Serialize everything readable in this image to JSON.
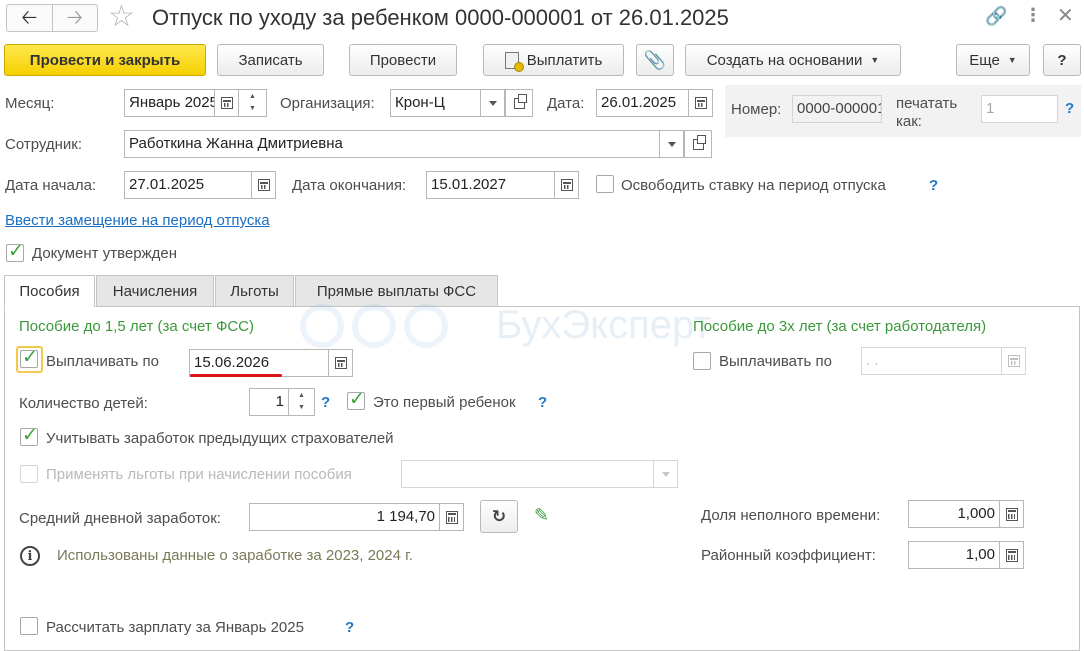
{
  "window": {
    "title": "Отпуск по уходу за ребенком 0000-000001 от 26.01.2025"
  },
  "toolbar": {
    "post_close": "Провести и закрыть",
    "save": "Записать",
    "post": "Провести",
    "pay": "Выплатить",
    "create_based": "Создать на основании",
    "more": "Еще",
    "help": "?"
  },
  "header": {
    "month_label": "Месяц:",
    "month_value": "Январь 2025",
    "org_label": "Организация:",
    "org_value": "Крон-Ц",
    "date_label": "Дата:",
    "date_value": "26.01.2025",
    "number_label": "Номер:",
    "number_value": "0000-000001",
    "print_as_label": "печатать как:",
    "print_as_value": "1",
    "employee_label": "Сотрудник:",
    "employee_value": "Работкина Жанна Дмитриевна",
    "start_label": "Дата начала:",
    "start_value": "27.01.2025",
    "end_label": "Дата окончания:",
    "end_value": "15.01.2027",
    "free_rate_label": "Освободить ставку на период отпуска",
    "substitution_link": "Ввести замещение на период отпуска",
    "approved_label": "Документ утвержден"
  },
  "tabs": [
    {
      "label": "Пособия"
    },
    {
      "label": "Начисления"
    },
    {
      "label": "Льготы"
    },
    {
      "label": "Прямые выплаты ФСС"
    }
  ],
  "benefits": {
    "fss_title": "Пособие до 1,5 лет (за счет ФСС)",
    "employer_title": "Пособие до 3х лет (за счет работодателя)",
    "pay_until_label": "Выплачивать по",
    "pay_until_value": "15.06.2026",
    "pay_until2_label": "Выплачивать по",
    "pay_until2_value": " .  .",
    "children_label": "Количество детей:",
    "children_value": "1",
    "first_child_label": "Это первый ребенок",
    "prev_insurers_label": "Учитывать заработок предыдущих страхователей",
    "apply_benefits_label": "Применять льготы при начислении пособия",
    "avg_daily_label": "Средний дневной заработок:",
    "avg_daily_value": "1 194,70",
    "part_time_label": "Доля неполного времени:",
    "part_time_value": "1,000",
    "regional_label": "Районный коэффициент:",
    "regional_value": "1,00",
    "info_text": "Использованы данные о заработке за  2023,  2024 г.",
    "calc_salary_label": "Рассчитать зарплату за Январь 2025"
  },
  "watermark": "БухЭксперт",
  "colors": {
    "primary_button": "#f6d000",
    "check_green": "#3aa23a",
    "group_title_green": "#3a9a3a",
    "link_blue": "#1b6ec2",
    "help_blue": "#1f78c8",
    "underline_red": "#d9141b"
  }
}
